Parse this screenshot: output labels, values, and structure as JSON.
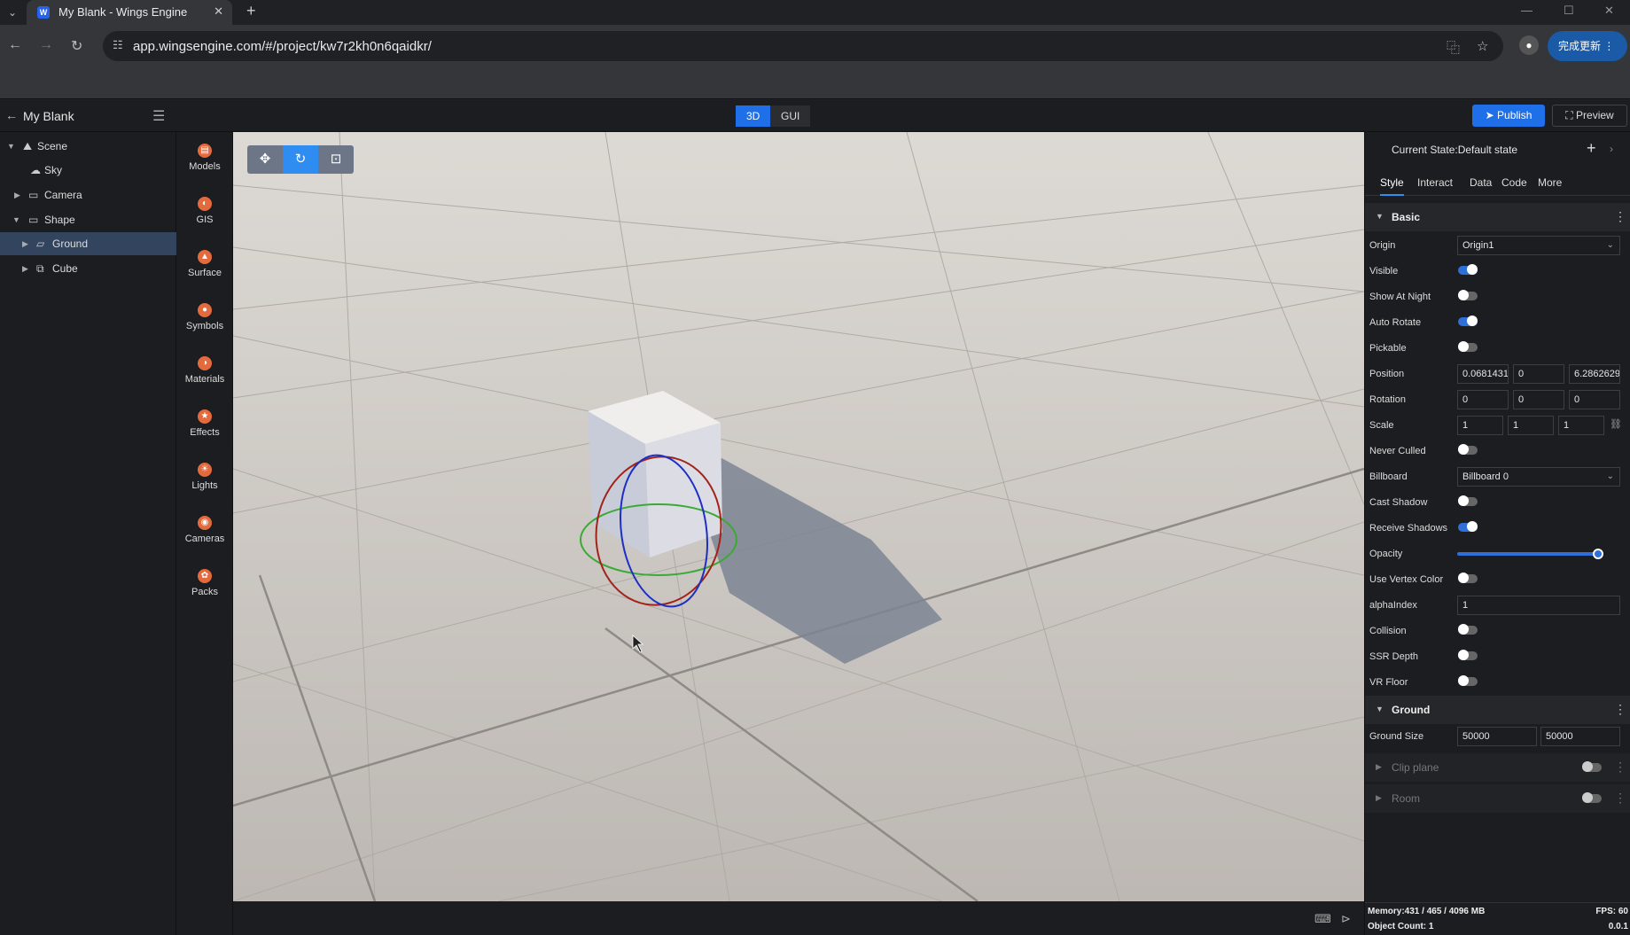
{
  "browser": {
    "tab_title": "My Blank - Wings Engine",
    "url": "app.wingsengine.com/#/project/kw7r2kh0n6qaidkr/",
    "update_label": "完成更新"
  },
  "app": {
    "project_name": "My Blank",
    "modes": [
      "3D",
      "GUI"
    ],
    "active_mode": "3D",
    "publish_label": "Publish",
    "preview_label": "Preview"
  },
  "scene_tree": [
    {
      "label": "Scene",
      "icon": "scene-icon",
      "expanded": true
    },
    {
      "label": "Sky",
      "icon": "weather-icon"
    },
    {
      "label": "Camera",
      "icon": "folder-icon",
      "expanded": false
    },
    {
      "label": "Shape",
      "icon": "folder-icon",
      "expanded": true
    },
    {
      "label": "Ground",
      "icon": "plane-icon",
      "selected": true
    },
    {
      "label": "Cube",
      "icon": "cube-icon"
    }
  ],
  "asset_bar": [
    {
      "label": "Models",
      "icon": "models-icon"
    },
    {
      "label": "GIS",
      "icon": "gis-icon"
    },
    {
      "label": "Surface",
      "icon": "surface-icon"
    },
    {
      "label": "Symbols",
      "icon": "symbols-icon"
    },
    {
      "label": "Materials",
      "icon": "materials-icon"
    },
    {
      "label": "Effects",
      "icon": "effects-icon"
    },
    {
      "label": "Lights",
      "icon": "lights-icon"
    },
    {
      "label": "Cameras",
      "icon": "cameras-icon"
    },
    {
      "label": "Packs",
      "icon": "packs-icon"
    }
  ],
  "props": {
    "state_label": "Current State:Default state",
    "tabs": [
      "Style",
      "Interact",
      "Data",
      "Code",
      "More"
    ],
    "active_tab": "Style",
    "basic_title": "Basic",
    "origin_label": "Origin",
    "origin_value": "Origin1",
    "visible_label": "Visible",
    "visible": true,
    "show_at_night_label": "Show At Night",
    "show_at_night": false,
    "auto_rotate_label": "Auto Rotate",
    "auto_rotate": true,
    "pickable_label": "Pickable",
    "pickable": false,
    "position_label": "Position",
    "position": [
      "0.0681431",
      "0",
      "6.2862629"
    ],
    "rotation_label": "Rotation",
    "rotation": [
      "0",
      "0",
      "0"
    ],
    "scale_label": "Scale",
    "scale": [
      "1",
      "1",
      "1"
    ],
    "never_culled_label": "Never Culled",
    "never_culled": false,
    "billboard_label": "Billboard",
    "billboard_value": "Billboard 0",
    "cast_shadow_label": "Cast Shadow",
    "cast_shadow": false,
    "receive_shadows_label": "Receive Shadows",
    "receive_shadows": true,
    "opacity_label": "Opacity",
    "opacity": 1,
    "use_vertex_color_label": "Use Vertex Color",
    "use_vertex_color": false,
    "alpha_index_label": "alphaIndex",
    "alpha_index": "1",
    "collision_label": "Collision",
    "collision": false,
    "ssr_depth_label": "SSR Depth",
    "ssr_depth": false,
    "vr_floor_label": "VR Floor",
    "vr_floor": false,
    "ground_title": "Ground",
    "ground_size_label": "Ground Size",
    "ground_size": [
      "50000",
      "50000"
    ],
    "clip_plane_label": "Clip plane",
    "room_label": "Room"
  },
  "footer": {
    "memory": "Memory:431 / 465 / 4096 MB",
    "fps": "FPS: 60",
    "object_count": "Object Count: 1",
    "version": "0.0.1"
  },
  "colors": {
    "accent": "#1e6fe8",
    "viewport_floor": "#c9c4bf",
    "gizmo_x": "#a3231b",
    "gizmo_y": "#1d2fc4",
    "gizmo_z": "#3aaa35"
  }
}
